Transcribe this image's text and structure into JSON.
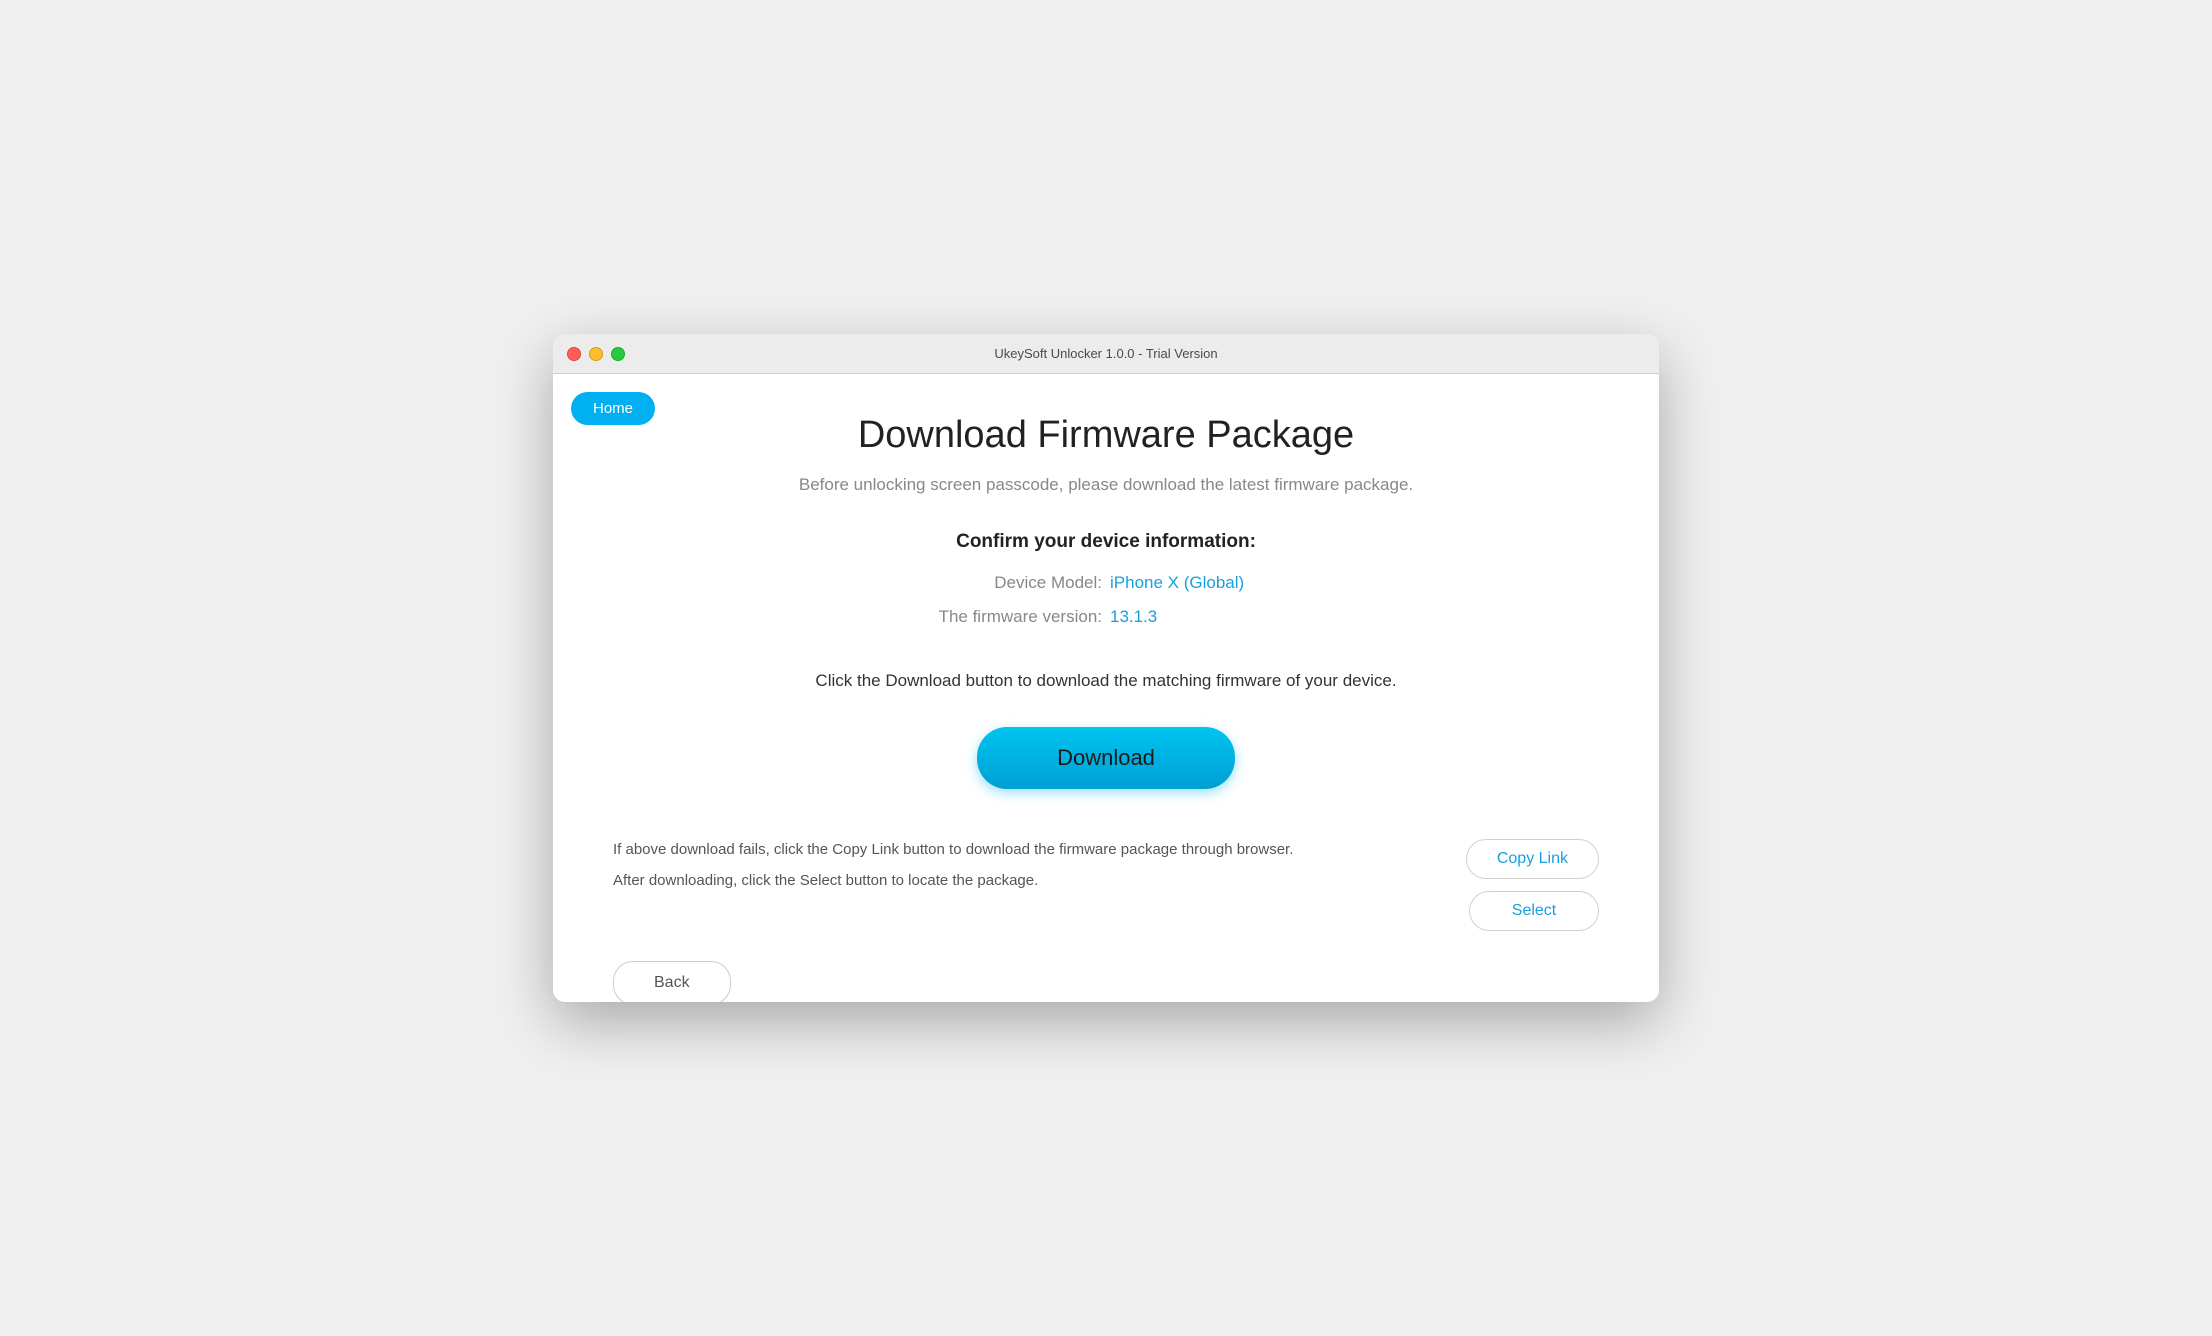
{
  "window": {
    "title": "UkeySoft Unlocker 1.0.0 - Trial Version"
  },
  "header": {
    "home_button_label": "Home"
  },
  "main": {
    "page_title": "Download Firmware Package",
    "subtitle": "Before unlocking screen passcode, please download the latest firmware package.",
    "device_info_title": "Confirm your device information:",
    "device_model_label": "Device Model:",
    "device_model_value": "iPhone X (Global)",
    "firmware_version_label": "The firmware version:",
    "firmware_version_value": "13.1.3",
    "instruction_text": "Click the Download button to download the matching firmware of your device.",
    "download_button_label": "Download"
  },
  "bottom": {
    "line1": "If above download fails, click the Copy Link button to download the firmware package through browser.",
    "line2": "After downloading, click the Select button to locate the package.",
    "copy_link_label": "Copy Link",
    "select_label": "Select"
  },
  "footer": {
    "back_button_label": "Back"
  }
}
